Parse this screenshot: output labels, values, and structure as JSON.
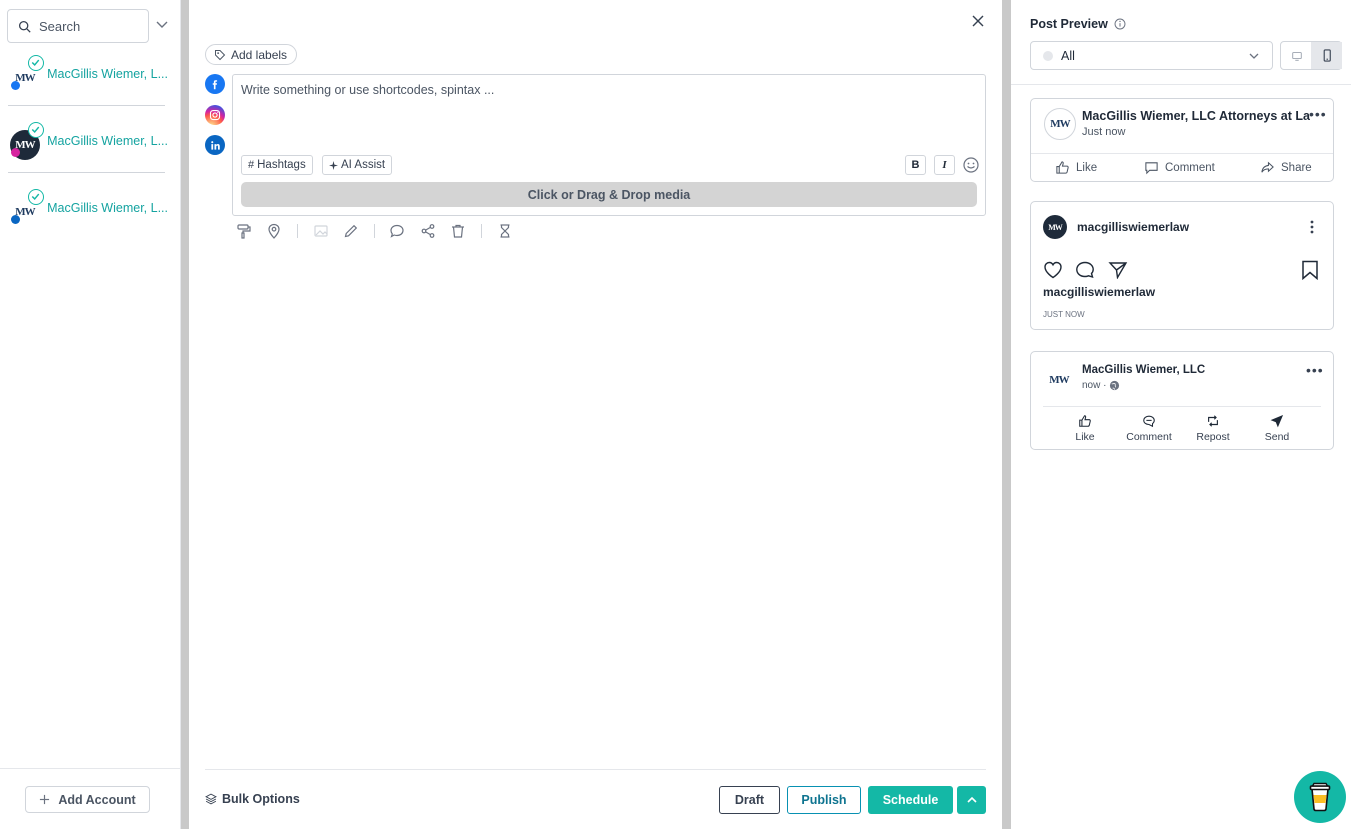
{
  "sidebar": {
    "search_placeholder": "Search",
    "accounts": [
      {
        "name": "MacGillis Wiemer, L...",
        "network": "facebook"
      },
      {
        "name": "MacGillis Wiemer, L...",
        "network": "instagram"
      },
      {
        "name": "MacGillis Wiemer, L...",
        "network": "linkedin"
      }
    ],
    "add_account_label": "Add Account"
  },
  "editor": {
    "add_labels": "Add labels",
    "compose_placeholder": "Write something or use shortcodes, spintax ...",
    "hashtags_label": "Hashtags",
    "ai_assist_label": "AI Assist",
    "bold_label": "B",
    "italic_label": "I",
    "media_drop_label": "Click or Drag & Drop media",
    "bulk_options_label": "Bulk Options",
    "draft_label": "Draft",
    "publish_label": "Publish",
    "schedule_label": "Schedule"
  },
  "preview": {
    "title": "Post Preview",
    "filter_value": "All",
    "facebook": {
      "page_name": "MacGillis Wiemer, LLC Attorneys at Law",
      "time": "Just now",
      "actions": [
        "Like",
        "Comment",
        "Share"
      ]
    },
    "instagram": {
      "username": "macgilliswiemerlaw",
      "caption_user": "macgilliswiemerlaw",
      "time": "JUST NOW"
    },
    "linkedin": {
      "company_name": "MacGillis Wiemer, LLC",
      "time": "now ·",
      "actions": [
        "Like",
        "Comment",
        "Repost",
        "Send"
      ]
    }
  },
  "colors": {
    "accent": "#14b8a6",
    "account_text": "#14a3a0",
    "facebook": "#1877f2",
    "linkedin": "#0a66c2"
  }
}
